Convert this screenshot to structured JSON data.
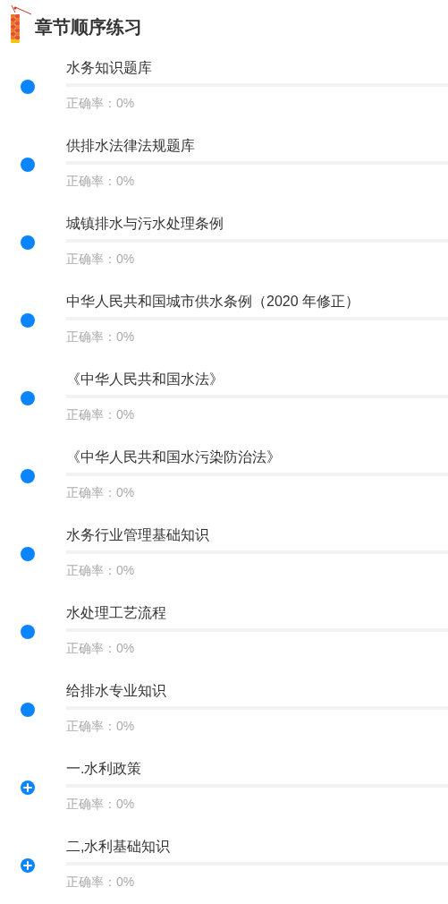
{
  "header": {
    "title": "章节顺序练习"
  },
  "chapters": [
    {
      "kind": "dot",
      "title": "水务知识题库",
      "accuracy": "正确率：0%"
    },
    {
      "kind": "dot",
      "title": "供排水法律法规题库",
      "accuracy": "正确率：0%"
    },
    {
      "kind": "dot",
      "title": "城镇排水与污水处理条例",
      "accuracy": "正确率：0%"
    },
    {
      "kind": "dot",
      "title": "中华人民共和国城市供水条例（2020 年修正）",
      "accuracy": "正确率：0%"
    },
    {
      "kind": "dot",
      "title": "《中华人民共和国水法》",
      "accuracy": "正确率：0%"
    },
    {
      "kind": "dot",
      "title": "《中华人民共和国水污染防治法》",
      "accuracy": "正确率：0%"
    },
    {
      "kind": "dot",
      "title": "水务行业管理基础知识",
      "accuracy": "正确率：0%"
    },
    {
      "kind": "dot",
      "title": "水处理工艺流程",
      "accuracy": "正确率：0%"
    },
    {
      "kind": "dot",
      "title": "给排水专业知识",
      "accuracy": "正确率：0%"
    },
    {
      "kind": "expandable",
      "title": "一.水利政策",
      "accuracy": "正确率：0%"
    },
    {
      "kind": "expandable",
      "title": "二,水利基础知识",
      "accuracy": "正确率：0%"
    }
  ]
}
